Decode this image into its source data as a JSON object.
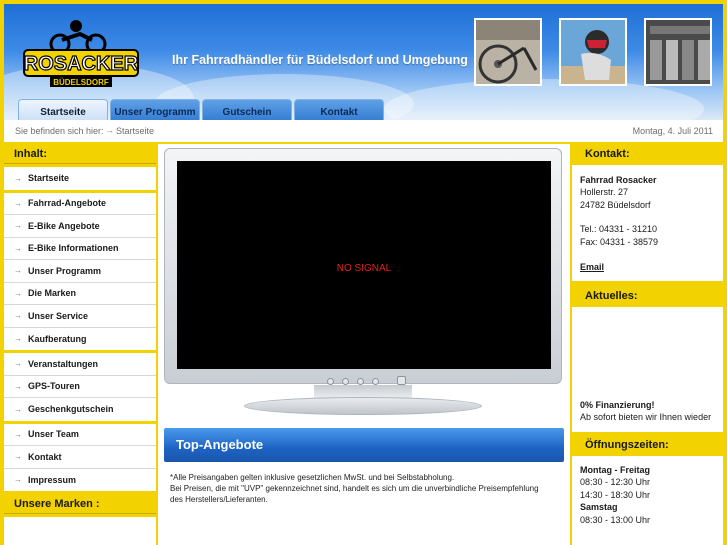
{
  "header": {
    "logo_text": "ROSACKER",
    "logo_subtext": "BÜDELSDORF",
    "tagline": "Ihr Fahrradhändler für Büdelsdorf und Umgebung"
  },
  "tabs": [
    {
      "label": "Startseite",
      "active": true
    },
    {
      "label": "Unser Programm",
      "active": false
    },
    {
      "label": "Gutschein",
      "active": false
    },
    {
      "label": "Kontakt",
      "active": false
    }
  ],
  "breadcrumb": {
    "label": "Sie befinden sich hier:",
    "current": "Startseite",
    "date": "Montag, 4. Juli 2011"
  },
  "sidebar": {
    "title": "Inhalt:",
    "groups": [
      [
        "Startseite"
      ],
      [
        "Fahrrad-Angebote",
        "E-Bike Angebote",
        "E-Bike Informationen",
        "Unser Programm",
        "Die Marken",
        "Unser Service",
        "Kaufberatung"
      ],
      [
        "Veranstaltungen",
        "GPS-Touren",
        "Geschenkgutschein"
      ],
      [
        "Unser Team",
        "Kontakt",
        "Impressum"
      ]
    ],
    "brands_title": "Unsere Marken :"
  },
  "main": {
    "screen_text": "NO SIGNAL",
    "section_title": "Top-Angebote",
    "note_1": "*Alle Preisangaben gelten inklusive gesetzlichen MwSt. und bei Selbstabholung.",
    "note_2": "Bei Preisen, die mit \"UVP\" gekennzeichnet sind, handelt es sich um die unverbindliche Preisempfehlung",
    "note_3": "des Herstellers/Lieferanten."
  },
  "contact": {
    "title": "Kontakt:",
    "name": "Fahrrad Rosacker",
    "street": "Hollerstr. 27",
    "city": "24782 Büdelsdorf",
    "tel": "Tel.: 04331 - 31210",
    "fax": "Fax: 04331 - 38579",
    "email": "Email"
  },
  "news": {
    "title": "Aktuelles:",
    "headline": "0% Finanzierung!",
    "text": "Ab sofort bieten wir Ihnen wieder"
  },
  "hours": {
    "title": "Öffnungszeiten:",
    "weekday_label": "Montag - Freitag",
    "weekday_morning": "08:30 - 12:30 Uhr",
    "weekday_afternoon": "14:30 - 18:30 Uhr",
    "saturday_label": "Samstag",
    "saturday_hours": "08:30 - 13:00 Uhr"
  },
  "colors": {
    "brand_yellow": "#f2d200",
    "header_blue": "#1f6fd6",
    "accent_blue": "#1e63c2",
    "no_signal_red": "#e0211c"
  }
}
